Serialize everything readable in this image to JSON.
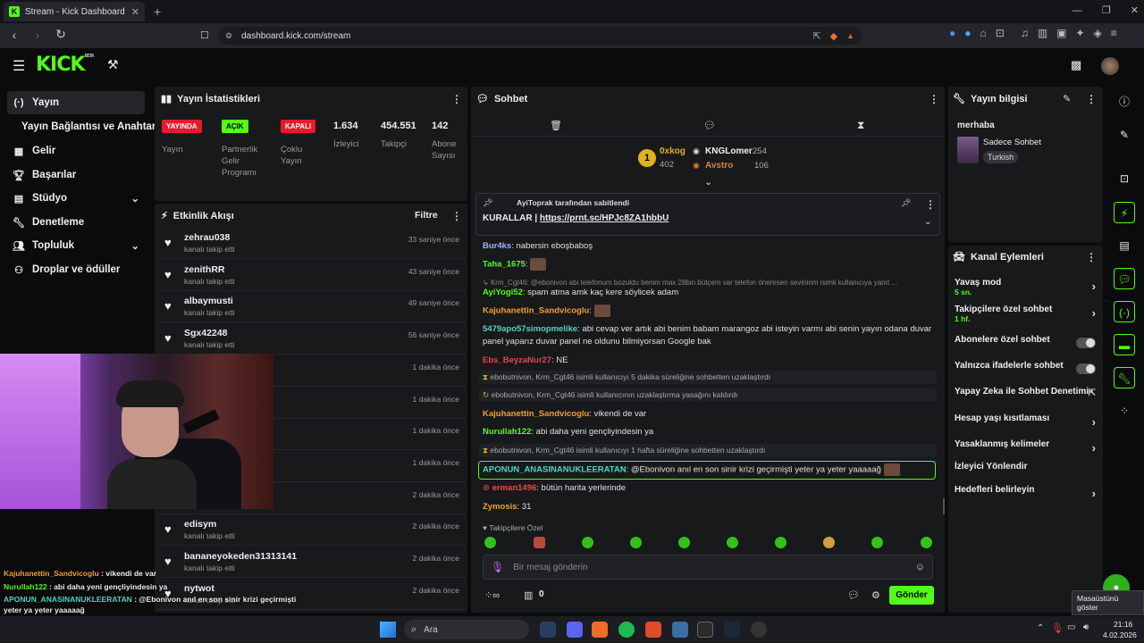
{
  "browser": {
    "tab_title": "Stream - Kick Dashboard",
    "url": "dashboard.kick.com/stream"
  },
  "kick": {
    "logo": "KICK",
    "logo_tag": "BETA"
  },
  "sidebar": {
    "items": [
      {
        "label": "Yayın",
        "icon": "broadcast-icon"
      },
      {
        "label": "Yayın Bağlantısı ve Anahtarı",
        "icon": ""
      },
      {
        "label": "Gelir",
        "icon": "revenue-icon"
      },
      {
        "label": "Başarılar",
        "icon": "trophy-icon"
      },
      {
        "label": "Stüdyo",
        "icon": "studio-icon"
      },
      {
        "label": "Denetleme",
        "icon": "wrench-icon"
      },
      {
        "label": "Topluluk",
        "icon": "people-icon"
      },
      {
        "label": "Droplar ve ödüller",
        "icon": "drops-icon"
      }
    ]
  },
  "stats": {
    "title": "Yayın İstatistikleri",
    "live_badge": "YAYINDA",
    "live_label": "Yayın",
    "partner_badge": "AÇIK",
    "partner_label": "Partnerlik Gelir Programı",
    "multi_badge": "KAPALI",
    "multi_label": "Çoklu Yayın",
    "viewers": "1.634",
    "viewers_label": "İzleyici",
    "followers": "454.551",
    "followers_label": "Takipçi",
    "subs": "142",
    "subs_label": "Abone Sayısı"
  },
  "activity": {
    "title": "Etkinlik Akışı",
    "filter": "Filtre",
    "items": [
      {
        "name": "zehrau038",
        "sub": "kanalı takip etti",
        "time": "33 saniye önce"
      },
      {
        "name": "zenithRR",
        "sub": "kanalı takip etti",
        "time": "43 saniye önce"
      },
      {
        "name": "albaymusti",
        "sub": "kanalı takip etti",
        "time": "49 saniye önce"
      },
      {
        "name": "Sgx42248",
        "sub": "kanalı takip etti",
        "time": "56 saniye önce"
      },
      {
        "name": "",
        "sub": "",
        "time": "1 dakika önce"
      },
      {
        "name": "",
        "sub": "",
        "time": "1 dakika önce"
      },
      {
        "name": "",
        "sub": "",
        "time": "1 dakika önce"
      },
      {
        "name": "",
        "sub": "",
        "time": "1 dakika önce"
      },
      {
        "name": "",
        "sub": "kanalı takip etti",
        "time": "2 dakika önce"
      },
      {
        "name": "edisym",
        "sub": "kanalı takip etti",
        "time": "2 dakika önce"
      },
      {
        "name": "bananeyokeden31313141",
        "sub": "kanalı takip etti",
        "time": "2 dakika önce"
      },
      {
        "name": "nytwot",
        "sub": "kanalı takip etti",
        "time": "2 dakika önce"
      }
    ]
  },
  "chat": {
    "title": "Sohbet",
    "top": {
      "first": {
        "name": "0xkog",
        "count": "402"
      },
      "second": {
        "name": "KNGLomer",
        "count": "254"
      },
      "third": {
        "name": "Avstro",
        "count": "106"
      }
    },
    "pinned_by": "AyiToprak tarafından sabitlendi",
    "pinned_text": "KURALLAR | ",
    "pinned_link": "https://prnt.sc/HPJc8ZA1hbbU",
    "messages": [
      {
        "user": "Bur4ks",
        "color": "#9bb8ff",
        "text": ": nabersin eboşbaboş"
      },
      {
        "user": "Taha_1675",
        "color": "#53fc18",
        "text": ":"
      },
      {
        "user": "",
        "color": "#888",
        "text": "Krm_Cgt46: @ebonivon abi telefonum bozuldu benim max 28bin bütçem var telefon önerirsen sevinirim isimli kullanıcıya yanıt ..."
      },
      {
        "user": "AyiYogi52",
        "color": "#53fc18",
        "text": ": spam atma amk kaç kere söylicek adam"
      },
      {
        "user": "Kajuhanettin_Sandvicoglu",
        "color": "#f0a030",
        "text": ":"
      },
      {
        "user": "5479apo57simopmelike",
        "color": "#4ed4c4",
        "text": ": abi cevap ver artık abi benim babam marangoz abi isteyin varmı abi senin yayın odana duvar panel yaparız duvar panel ne oldunu bilmiyorsan Google bak"
      },
      {
        "user": "Ebs_BeyzaNur27",
        "color": "#e0455a",
        "text": ": NE"
      },
      {
        "user": "Kajuhanettin_Sandvicoglu",
        "color": "#f0a030",
        "text": ": vikendi de var"
      },
      {
        "user": "Nurullah122",
        "color": "#53fc18",
        "text": ": abi daha yeni gençliyindesin ya"
      },
      {
        "user": "APONUN_ANASINANUKLEERATAN",
        "color": "#4ed4c4",
        "text": ": @Ebonivon anıl en son sinir krizi geçirmişti yeter ya yeter yaaaaağ"
      },
      {
        "user": "erman1496",
        "color": "#f04848",
        "text": ": bütün harita yerlerinde"
      },
      {
        "user": "Zymosis",
        "color": "#f0a030",
        "text": ": 31"
      }
    ],
    "system": [
      "ebobutnivon, Krm_Cgt46 isimli kullanıcıyı 5 dakika süreliğine sohbetten uzaklaştırdı",
      "ebobutnivon, Krm_Cgt46 isimli kullanıcının uzaklaştırma yasağını kaldırdı",
      "ebobutnivon, Krm_Cgt46 isimli kullanıcıyı 1 hafta süreliğine sohbetten uzaklaştırdı"
    ],
    "subs_only_label": "Takipçilere Özel",
    "input_placeholder": "Bir mesaj gönderin",
    "points": "0",
    "send": "Gönder"
  },
  "stream_info": {
    "title": "Yayın bilgisi",
    "stream_title": "merhaba",
    "category": "Sadece Sohbet",
    "tag": "Turkish"
  },
  "channel_actions": {
    "title": "Kanal Eylemleri",
    "slow_mode": "Yavaş mod",
    "slow_value": "5 sn.",
    "followers_only": "Takipçilere özel sohbet",
    "followers_value": "1 hf.",
    "subs_only": "Abonelere özel sohbet",
    "emotes_only": "Yalnızca ifadelerle sohbet",
    "ai_mod": "Yapay Zeka ile Sohbet Denetimi",
    "age": "Hesap yaşı kısıtlaması",
    "banned_words": "Yasaklanmış kelimeler",
    "viewer_redirect": "İzleyici Yönlendir",
    "goals": "Hedefleri belirleyin"
  },
  "overlay": {
    "lines": [
      {
        "user": "Kajuhanettin_Sandvicoglu",
        "color": "#f0a030",
        "text": " : vikendi de var"
      },
      {
        "user": "Nurullah122",
        "color": "#53fc18",
        "text": " : abi daha yeni gençliyindesin ya"
      },
      {
        "user": "APONUN_ANASINANUKLEERATAN",
        "color": "#4ed4c4",
        "text": " : @Ebonivon anıl en son sinir krizi geçirmişti"
      },
      {
        "user": "",
        "color": "#eee",
        "text": "yeter ya yeter yaaaaağ"
      },
      {
        "user": "erman1496",
        "color": "#f04848",
        "text": " : bütün harita yerlerinde"
      },
      {
        "user": "Zymosis",
        "color": "#f0a030",
        "text": " : 31"
      }
    ]
  },
  "tooltip": "Masaüstünü göster",
  "taskbar": {
    "search": "Ara",
    "time": "21:16",
    "date": "4.02.2026"
  },
  "colors": {
    "accent": "#53fc18",
    "live": "#e8192c",
    "bg": "#0b0b0c",
    "panel": "#18191b"
  }
}
